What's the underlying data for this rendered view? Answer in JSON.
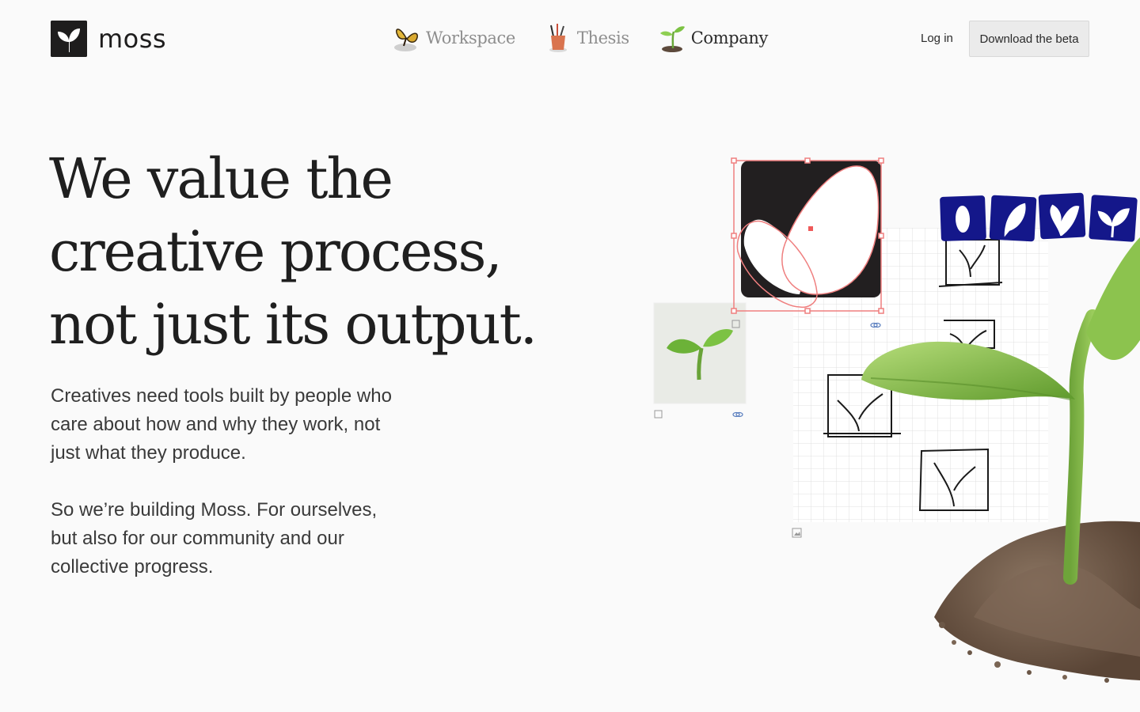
{
  "brand": {
    "name": "moss"
  },
  "nav": {
    "items": [
      {
        "label": "Workspace",
        "icon": "butterfly-icon",
        "active": false
      },
      {
        "label": "Thesis",
        "icon": "pencil-cup-icon",
        "active": false
      },
      {
        "label": "Company",
        "icon": "sprout-icon",
        "active": true
      }
    ],
    "login_label": "Log in",
    "beta_label": "Download the beta"
  },
  "hero": {
    "headline_lines": [
      "We value the",
      "creative process,",
      "not just its output."
    ],
    "paragraph1": "Creatives need tools built by people who care about how and why they work, not just what they produce.",
    "paragraph2": "So we’re building Moss. For ourselves, but also for our community and our collective progress."
  },
  "colors": {
    "background": "#fafafa",
    "text": "#1f1f1f",
    "muted_nav": "#8e8e8e",
    "selection": "#ef7f7f",
    "logo_blue": "#14178a",
    "leaf_green": "#7cc243",
    "soil": "#6b5747"
  }
}
